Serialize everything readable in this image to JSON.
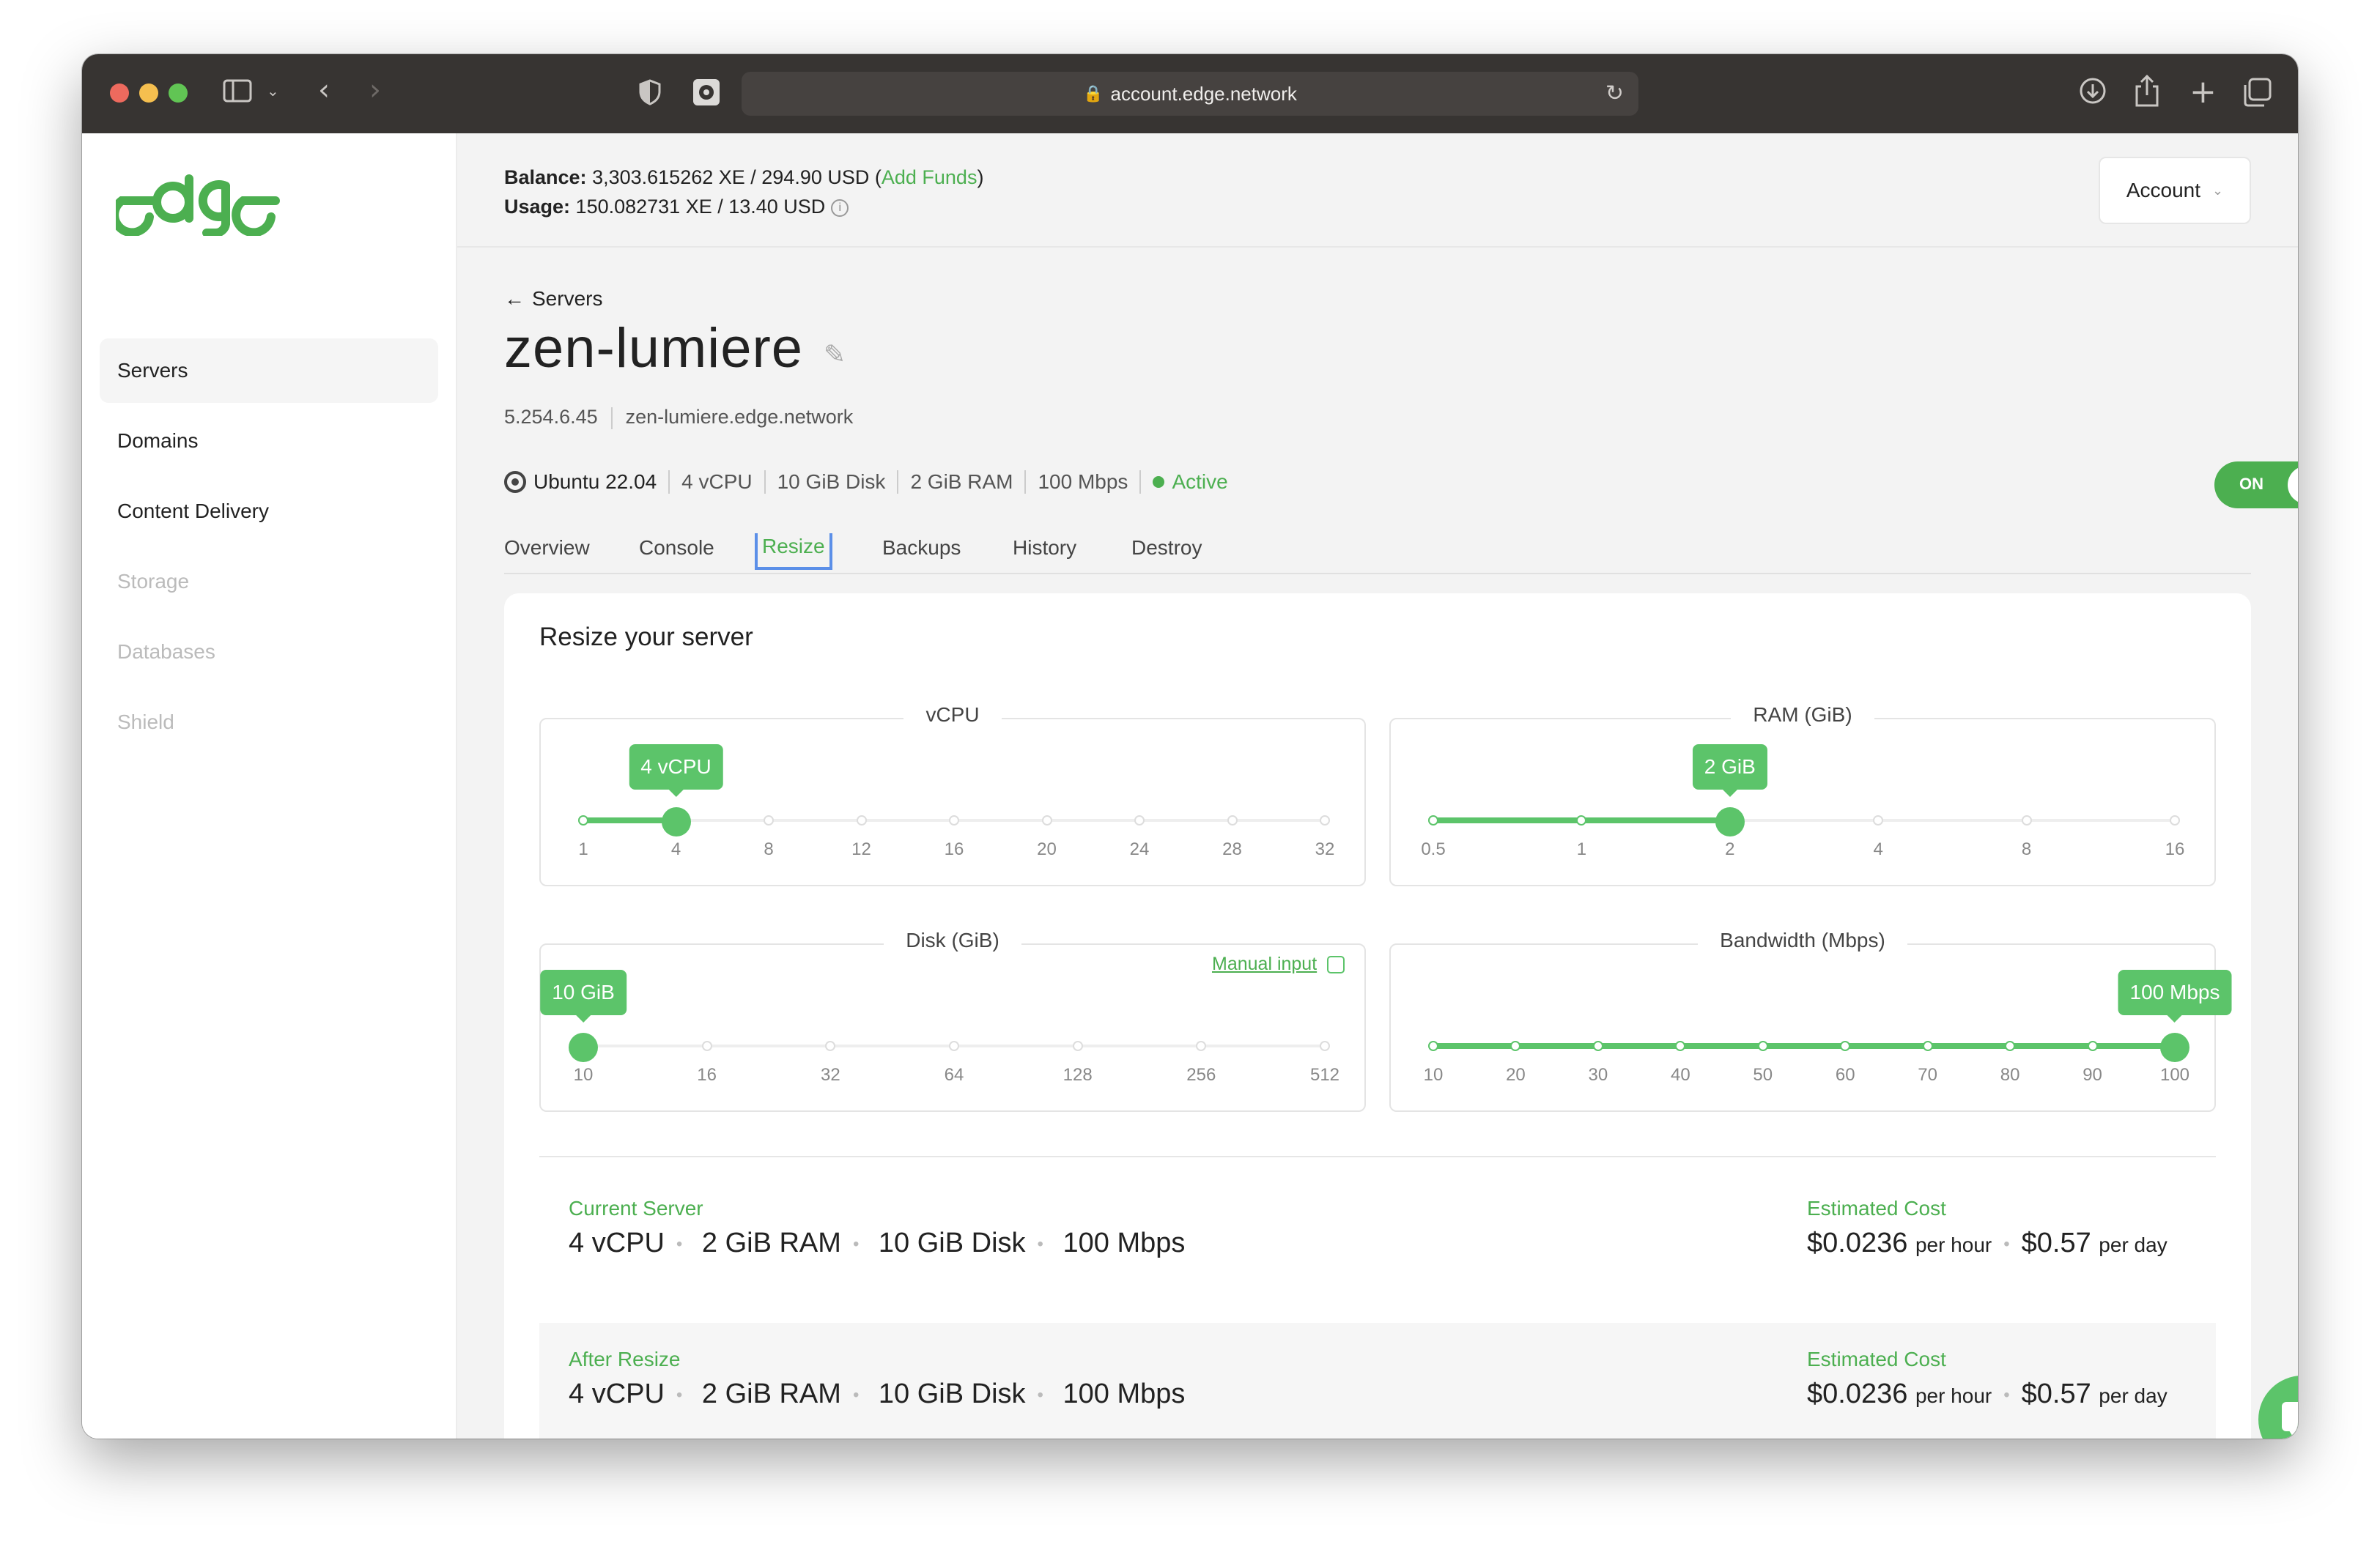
{
  "browser": {
    "url": "account.edge.network"
  },
  "sidebar": {
    "logo_text": "edge",
    "items": [
      {
        "label": "Servers",
        "state": "active"
      },
      {
        "label": "Domains",
        "state": "enabled"
      },
      {
        "label": "Content Delivery",
        "state": "enabled"
      },
      {
        "label": "Storage",
        "state": "disabled"
      },
      {
        "label": "Databases",
        "state": "disabled"
      },
      {
        "label": "Shield",
        "state": "disabled"
      }
    ]
  },
  "header": {
    "balance_label": "Balance:",
    "balance_value": "3,303.615262 XE / 294.90 USD",
    "add_funds": "Add Funds",
    "usage_label": "Usage:",
    "usage_value": "150.082731 XE / 13.40 USD",
    "account_button": "Account"
  },
  "server": {
    "back_label": "Servers",
    "name": "zen-lumiere",
    "ip": "5.254.6.45",
    "hostname": "zen-lumiere.edge.network",
    "os": "Ubuntu 22.04",
    "vcpu": "4 vCPU",
    "disk": "10 GiB Disk",
    "ram": "2 GiB RAM",
    "bandwidth": "100 Mbps",
    "status": "Active",
    "power_toggle": "ON"
  },
  "tabs": [
    "Overview",
    "Console",
    "Resize",
    "Backups",
    "History",
    "Destroy"
  ],
  "active_tab": "Resize",
  "resize": {
    "title": "Resize your server",
    "sliders": {
      "vcpu": {
        "legend": "vCPU",
        "ticks": [
          "1",
          "4",
          "8",
          "12",
          "16",
          "20",
          "24",
          "28",
          "32"
        ],
        "selected_index": 1,
        "bubble": "4 vCPU"
      },
      "ram": {
        "legend": "RAM (GiB)",
        "ticks": [
          "0.5",
          "1",
          "2",
          "4",
          "8",
          "16"
        ],
        "selected_index": 2,
        "bubble": "2 GiB"
      },
      "disk": {
        "legend": "Disk (GiB)",
        "ticks": [
          "10",
          "16",
          "32",
          "64",
          "128",
          "256",
          "512"
        ],
        "selected_index": 0,
        "bubble": "10 GiB",
        "manual_input": "Manual input"
      },
      "bandwidth": {
        "legend": "Bandwidth (Mbps)",
        "ticks": [
          "10",
          "20",
          "30",
          "40",
          "50",
          "60",
          "70",
          "80",
          "90",
          "100"
        ],
        "selected_index": 9,
        "bubble": "100 Mbps"
      }
    },
    "current": {
      "label": "Current Server",
      "vcpu": "4 vCPU",
      "ram": "2 GiB RAM",
      "disk": "10 GiB Disk",
      "bandwidth": "100 Mbps",
      "cost_label": "Estimated Cost",
      "per_hour_value": "$0.0236",
      "per_hour_unit": "per hour",
      "per_day_value": "$0.57",
      "per_day_unit": "per day"
    },
    "after": {
      "label": "After Resize",
      "vcpu": "4 vCPU",
      "ram": "2 GiB RAM",
      "disk": "10 GiB Disk",
      "bandwidth": "100 Mbps",
      "cost_label": "Estimated Cost",
      "per_hour_value": "$0.0236",
      "per_hour_unit": "per hour",
      "per_day_value": "$0.57",
      "per_day_unit": "per day"
    }
  },
  "colors": {
    "accent": "#5cc46a",
    "titlebar": "#373432",
    "tab_focus": "#5b8fe8"
  }
}
